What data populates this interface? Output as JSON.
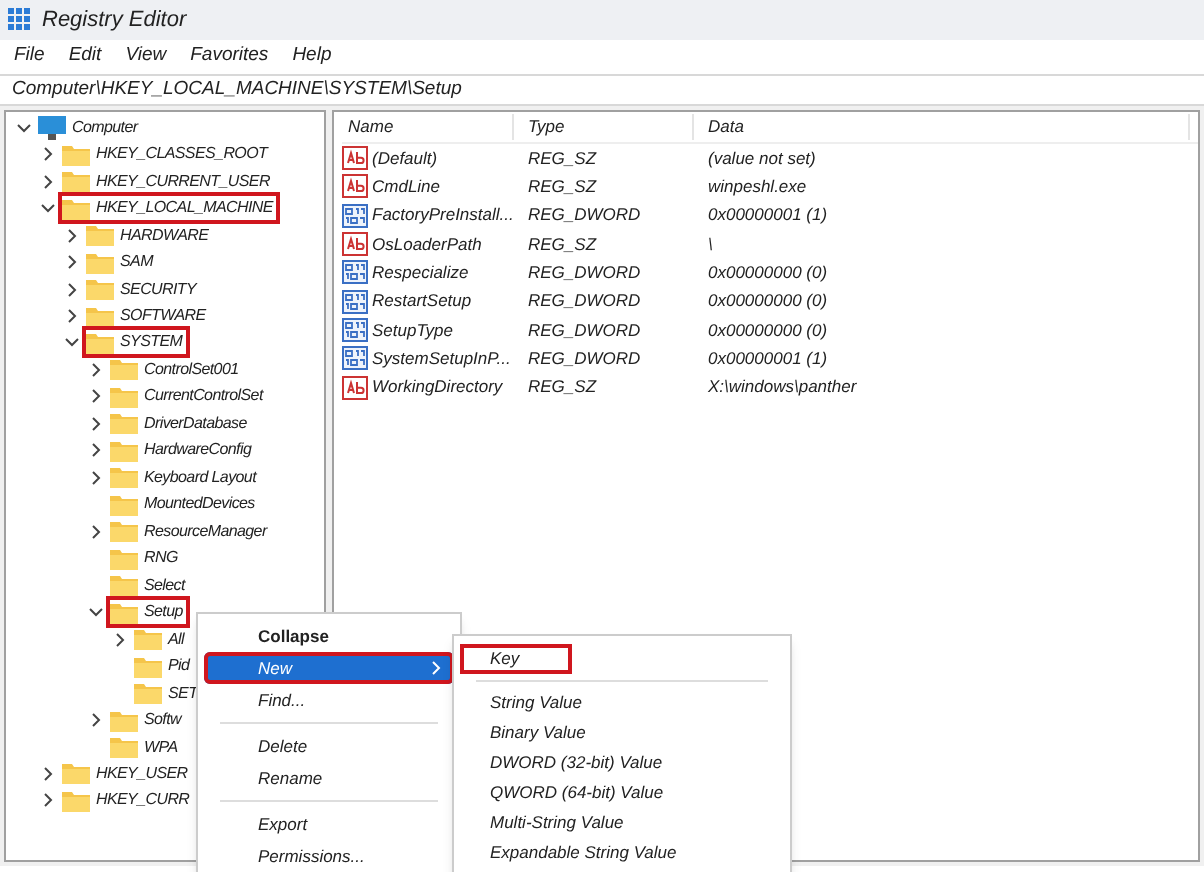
{
  "window": {
    "title": "Registry Editor"
  },
  "menu": [
    "File",
    "Edit",
    "View",
    "Favorites",
    "Help"
  ],
  "address": "Computer\\HKEY_LOCAL_MACHINE\\SYSTEM\\Setup",
  "tree": [
    {
      "label": "Computer",
      "kind": "computer",
      "expanded": true,
      "marked": false,
      "children": [
        {
          "label": "HKEY_CLASSES_ROOT",
          "expanded": false,
          "marked": false
        },
        {
          "label": "HKEY_CURRENT_USER",
          "expanded": false,
          "marked": false
        },
        {
          "label": "HKEY_LOCAL_MACHINE",
          "expanded": true,
          "marked": true,
          "children": [
            {
              "label": "HARDWARE",
              "expanded": false,
              "marked": false
            },
            {
              "label": "SAM",
              "expanded": false,
              "marked": false
            },
            {
              "label": "SECURITY",
              "expanded": false,
              "marked": false
            },
            {
              "label": "SOFTWARE",
              "expanded": false,
              "marked": false
            },
            {
              "label": "SYSTEM",
              "expanded": true,
              "marked": true,
              "children": [
                {
                  "label": "ControlSet001",
                  "expanded": false,
                  "marked": false
                },
                {
                  "label": "CurrentControlSet",
                  "expanded": false,
                  "marked": false
                },
                {
                  "label": "DriverDatabase",
                  "expanded": false,
                  "marked": false
                },
                {
                  "label": "HardwareConfig",
                  "expanded": false,
                  "marked": false
                },
                {
                  "label": "Keyboard Layout",
                  "expanded": false,
                  "marked": false
                },
                {
                  "label": "MountedDevices",
                  "marked": false
                },
                {
                  "label": "ResourceManager",
                  "expanded": false,
                  "marked": false
                },
                {
                  "label": "RNG",
                  "marked": false
                },
                {
                  "label": "Select",
                  "marked": false
                },
                {
                  "label": "Setup",
                  "expanded": true,
                  "marked": true,
                  "children": [
                    {
                      "label": "All",
                      "expanded": false,
                      "marked": false
                    },
                    {
                      "label": "Pid",
                      "marked": false
                    },
                    {
                      "label": "SET",
                      "marked": false
                    }
                  ]
                },
                {
                  "label": "Softw",
                  "expanded": false,
                  "marked": false
                },
                {
                  "label": "WPA",
                  "marked": false
                }
              ]
            }
          ]
        },
        {
          "label": "HKEY_USER",
          "expanded": false,
          "marked": false
        },
        {
          "label": "HKEY_CURR",
          "expanded": false,
          "marked": false
        }
      ]
    }
  ],
  "columns": [
    "Name",
    "Type",
    "Data"
  ],
  "values": [
    {
      "name": "(Default)",
      "type": "REG_SZ",
      "data": "(value not set)",
      "kind": "string"
    },
    {
      "name": "CmdLine",
      "type": "REG_SZ",
      "data": "winpeshl.exe",
      "kind": "string"
    },
    {
      "name": "FactoryPreInstall...",
      "type": "REG_DWORD",
      "data": "0x00000001 (1)",
      "kind": "binary"
    },
    {
      "name": "OsLoaderPath",
      "type": "REG_SZ",
      "data": "\\",
      "kind": "string"
    },
    {
      "name": "Respecialize",
      "type": "REG_DWORD",
      "data": "0x00000000 (0)",
      "kind": "binary"
    },
    {
      "name": "RestartSetup",
      "type": "REG_DWORD",
      "data": "0x00000000 (0)",
      "kind": "binary"
    },
    {
      "name": "SetupType",
      "type": "REG_DWORD",
      "data": "0x00000000 (0)",
      "kind": "binary"
    },
    {
      "name": "SystemSetupInP...",
      "type": "REG_DWORD",
      "data": "0x00000001 (1)",
      "kind": "binary"
    },
    {
      "name": "WorkingDirectory",
      "type": "REG_SZ",
      "data": "X:\\windows\\panther",
      "kind": "string"
    }
  ],
  "context_menu": [
    {
      "label": "Collapse",
      "kind": "default",
      "selected": false,
      "marked": false,
      "submenu": false
    },
    {
      "label": "New",
      "kind": "item",
      "selected": true,
      "marked": true,
      "submenu": true
    },
    {
      "label": "Find...",
      "kind": "item",
      "selected": false,
      "marked": false,
      "submenu": false
    },
    {
      "kind": "separator"
    },
    {
      "label": "Delete",
      "kind": "item",
      "selected": false,
      "marked": false,
      "submenu": false
    },
    {
      "label": "Rename",
      "kind": "item",
      "selected": false,
      "marked": false,
      "submenu": false
    },
    {
      "kind": "separator"
    },
    {
      "label": "Export",
      "kind": "item",
      "selected": false,
      "marked": false,
      "submenu": false
    },
    {
      "label": "Permissions...",
      "kind": "item",
      "selected": false,
      "marked": false,
      "submenu": false
    }
  ],
  "submenu": [
    {
      "label": "Key",
      "kind": "item",
      "marked": true
    },
    {
      "kind": "separator"
    },
    {
      "label": "String Value",
      "kind": "item",
      "marked": false
    },
    {
      "label": "Binary Value",
      "kind": "item",
      "marked": false
    },
    {
      "label": "DWORD (32-bit) Value",
      "kind": "item",
      "marked": false
    },
    {
      "label": "QWORD (64-bit) Value",
      "kind": "item",
      "marked": false
    },
    {
      "label": "Multi-String Value",
      "kind": "item",
      "marked": false
    },
    {
      "label": "Expandable String Value",
      "kind": "item",
      "marked": false
    }
  ]
}
